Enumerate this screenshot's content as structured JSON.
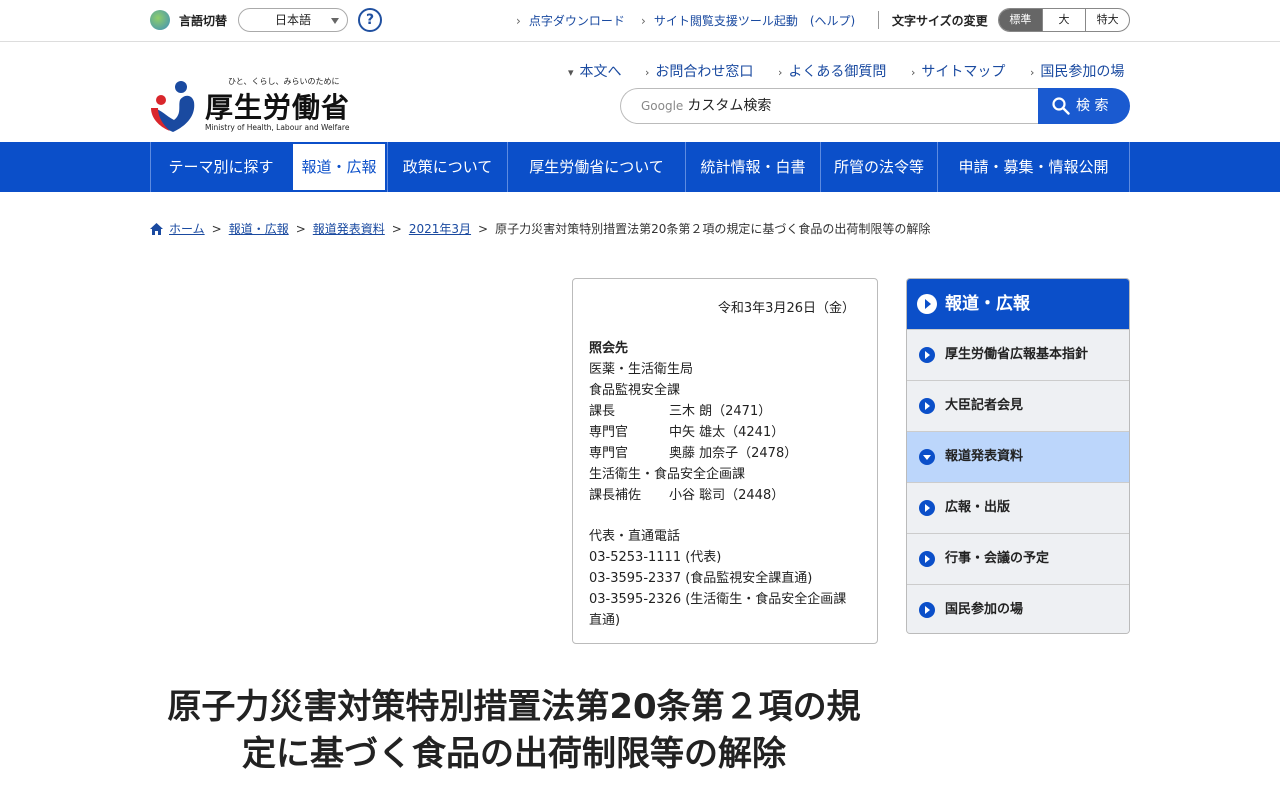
{
  "topbar": {
    "lang_label": "言語切替",
    "lang_value": "日本語",
    "help": "?",
    "braille_download": "点字ダウンロード",
    "accessibility_tool": "サイト閲覧支援ツール起動　(ヘルプ)",
    "fontsize_label": "文字サイズの変更",
    "fontsize_options": [
      "標準",
      "大",
      "特大"
    ],
    "fontsize_selected": "標準"
  },
  "header": {
    "logo_tagline": "ひと、くらし、みらいのために",
    "logo_name": "厚生労働省",
    "logo_en": "Ministry of Health, Labour and Welfare",
    "links": [
      "本文へ",
      "お問合わせ窓口",
      "よくある御質問",
      "サイトマップ",
      "国民参加の場"
    ],
    "search_google": "Google",
    "search_placeholder": "カスタム検索",
    "search_button": "検 索"
  },
  "nav": {
    "items": [
      "テーマ別に探す",
      "報道・広報",
      "政策について",
      "厚生労働省について",
      "統計情報・白書",
      "所管の法令等",
      "申請・募集・情報公開"
    ],
    "active": "報道・広報"
  },
  "breadcrumb": {
    "items": [
      "ホーム",
      "報道・広報",
      "報道発表資料",
      "2021年3月"
    ],
    "current": "原子力災害対策特別措置法第20条第２項の規定に基づく食品の出荷制限等の解除"
  },
  "contact": {
    "date": "令和3年3月26日（金）",
    "heading": "照会先",
    "bureau": "医薬・生活衛生局",
    "division": "食品監視安全課",
    "staff": [
      {
        "role": "課長",
        "name": "三木 朗（2471）"
      },
      {
        "role": "専門官",
        "name": "中矢 雄太（4241）"
      },
      {
        "role": "専門官",
        "name": "奥藤 加奈子（2478）"
      }
    ],
    "division2": "生活衛生・食品安全企画課",
    "staff2": {
      "role": "課長補佐",
      "name": "小谷 聡司（2448）"
    },
    "phone_heading": "代表・直通電話",
    "phones": [
      "03-5253-1111 (代表)",
      "03-3595-2337 (食品監視安全課直通)",
      "03-3595-2326 (生活衛生・食品安全企画課"
    ],
    "phone_tail": "直通)"
  },
  "sidebar": {
    "heading": "報道・広報",
    "items": [
      "厚生労働省広報基本指針",
      "大臣記者会見",
      "報道発表資料",
      "広報・出版",
      "行事・会議の予定",
      "国民参加の場"
    ],
    "current": "報道発表資料"
  },
  "title": {
    "line1": "原子力災害対策特別措置法第20条第２項の規",
    "line2": "定に基づく食品の出荷制限等の解除"
  },
  "colors": {
    "brand_blue": "#0b4fc9",
    "link_blue": "#1a4aa0",
    "sidebar_current": "#bcd6fb"
  }
}
